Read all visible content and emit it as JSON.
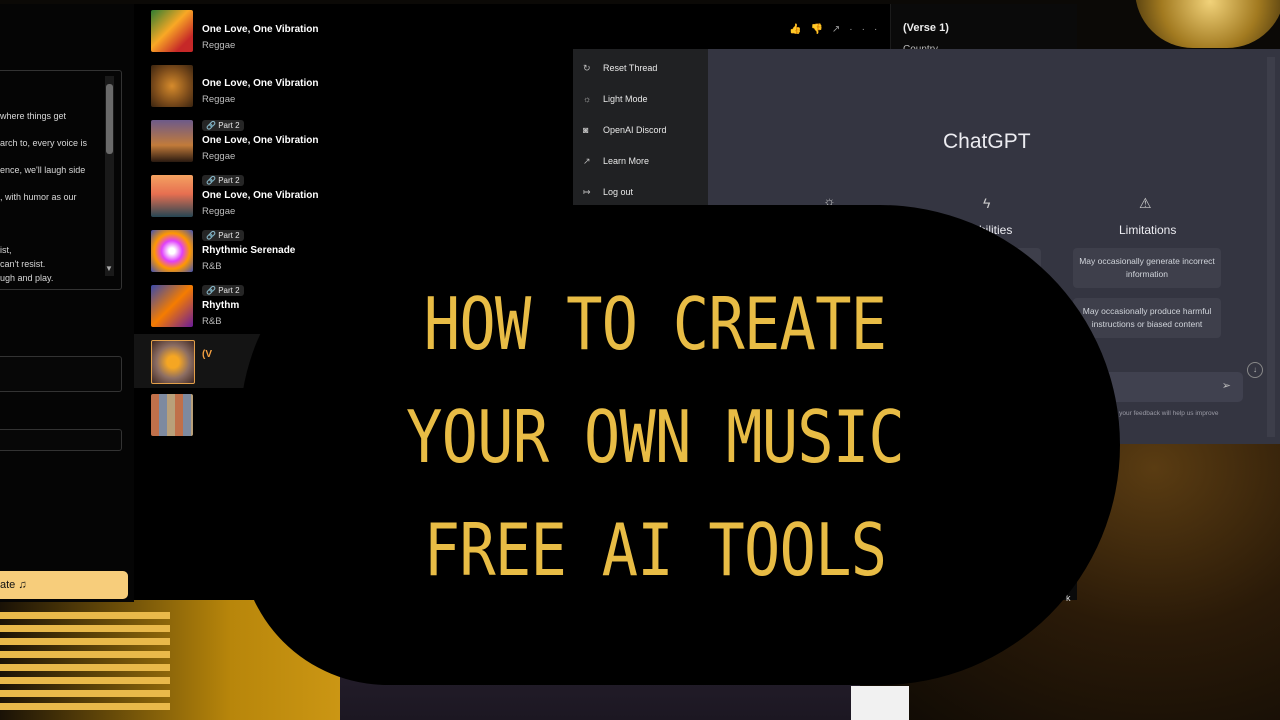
{
  "songs": [
    {
      "title": "One Love, One Vibration",
      "genre": "Reggae",
      "part": ""
    },
    {
      "title": "One Love, One Vibration",
      "genre": "Reggae",
      "part": ""
    },
    {
      "title": "One Love, One Vibration",
      "genre": "Reggae",
      "part": "Part 2"
    },
    {
      "title": "One Love, One Vibration",
      "genre": "Reggae",
      "part": "Part 2"
    },
    {
      "title": "Rhythmic Serenade",
      "genre": "R&B",
      "part": "Part 2"
    },
    {
      "title": "Rhythm",
      "genre": "R&B",
      "part": "Part 2"
    },
    {
      "title": "(V",
      "genre": "",
      "part": ""
    }
  ],
  "lyrics_snippets": [
    "where things get",
    "arch to, every voice is",
    "ence, we'll laugh side",
    ", with humor as our",
    "ist,",
    "can't resist.",
    "ugh and play."
  ],
  "create_button": "ate ♫",
  "lyrics_panel": {
    "verse": "(Verse 1)",
    "sub": "Country"
  },
  "trail_text": "k",
  "actions": {
    "like": "👍",
    "dislike": "👎",
    "share": "↗",
    "more": "···"
  },
  "chatgpt": {
    "menu": [
      {
        "icon": "↻",
        "label": "Reset Thread"
      },
      {
        "icon": "☼",
        "label": "Light Mode"
      },
      {
        "icon": "◙",
        "label": "OpenAI Discord"
      },
      {
        "icon": "↗",
        "label": "Learn More"
      },
      {
        "icon": "↦",
        "label": "Log out"
      }
    ],
    "title": "ChatGPT",
    "capabilities_head": "bilities",
    "capabilities_snip": "d",
    "limitations_head": "Limitations",
    "limitations": [
      "May occasionally generate incorrect information",
      "May occasionally produce harmful instructions or biased content"
    ],
    "send_icon": "➢",
    "down_icon": "↓",
    "footer": "ith, and your feedback will help us improve"
  },
  "headline": [
    "HOW TO CREATE",
    "YOUR OWN MUSIC",
    "FREE AI TOOLS"
  ],
  "colors": {
    "accent": "#e8bc45",
    "button": "#f7cd7b",
    "gpt_bg": "#343541"
  }
}
